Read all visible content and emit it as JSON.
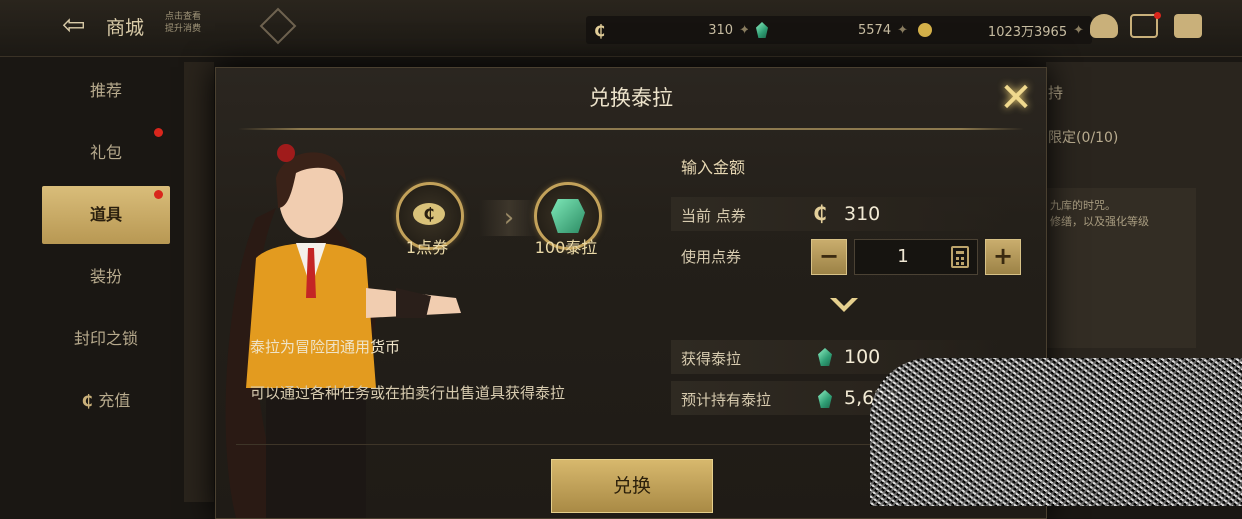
{
  "topbar": {
    "title": "商城",
    "subtitle": "点击查看\n提升消费",
    "currencies": [
      {
        "icon": "coupon-icon",
        "value": "310"
      },
      {
        "icon": "tera-gem-icon",
        "value": "5574"
      },
      {
        "icon": "gold-coin-icon",
        "value": "1023万3965"
      }
    ]
  },
  "sidebar": {
    "items": [
      {
        "label": "推荐",
        "active": false
      },
      {
        "label": "礼包",
        "active": false,
        "dot": true
      },
      {
        "label": "道具",
        "active": true,
        "dot": true
      },
      {
        "label": "装扮",
        "active": false
      },
      {
        "label": "封印之锁",
        "active": false
      },
      {
        "label": "充值",
        "active": false
      }
    ]
  },
  "background_panel": {
    "tab": "持",
    "limit": "限定(0/10)",
    "desc": "九库的时咒。\n修缮，以及强化等级"
  },
  "modal": {
    "title": "兑换泰拉",
    "from_label": "1点券",
    "to_label": "100泰拉",
    "desc_title": "泰拉为冒险团通用货币",
    "desc_body": "可以通过各种任务或在拍卖行出售道具获得泰拉",
    "section_title": "输入金额",
    "current_label": "当前 点券",
    "current_value": "310",
    "use_label": "使用点券",
    "use_value": "1",
    "minus": "−",
    "plus": "+",
    "gain_label": "获得泰拉",
    "gain_value": "100",
    "expected_label": "预计持有泰拉",
    "expected_value": "5,674",
    "confirm": "兑换"
  },
  "colors": {
    "accent_gold": "#c9ad6d",
    "tera_green": "#3fbf8a",
    "panel_bg": "#231f19"
  }
}
